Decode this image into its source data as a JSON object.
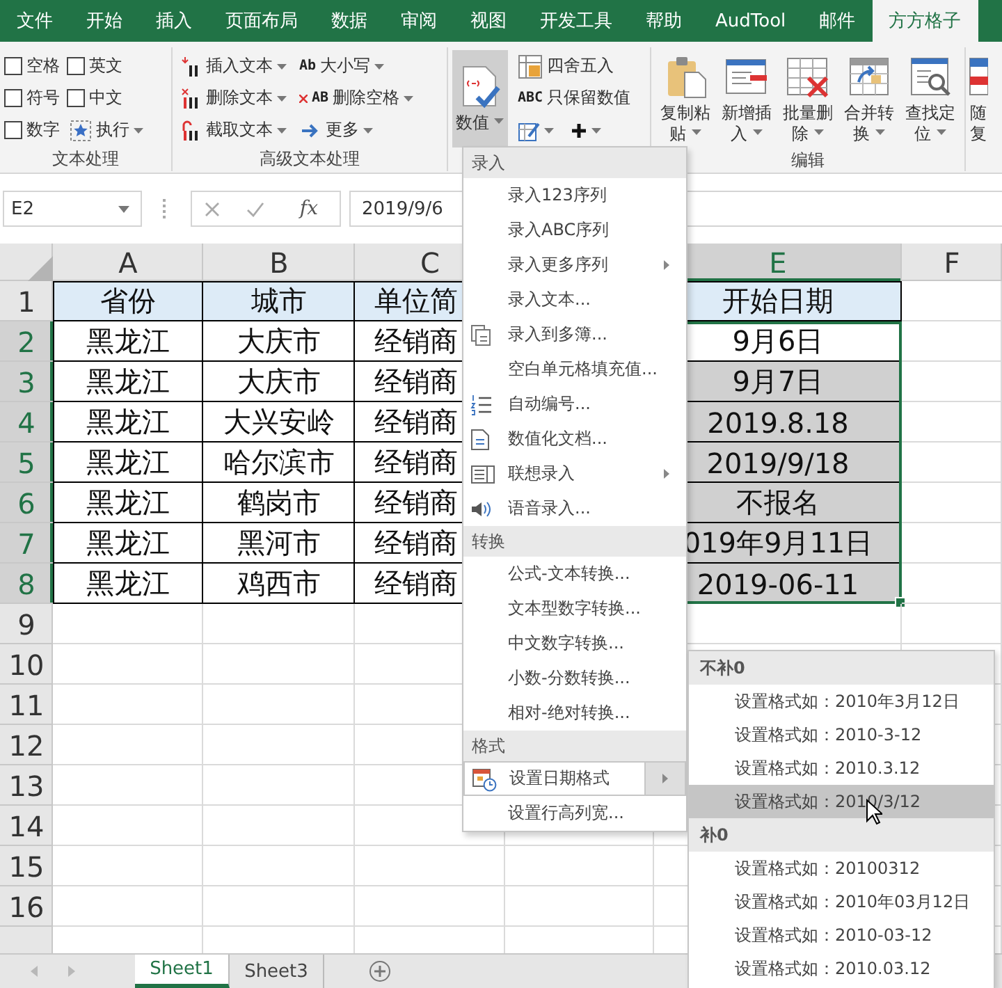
{
  "menu_tabs": [
    {
      "label": "文件",
      "selected": false
    },
    {
      "label": "开始",
      "selected": false
    },
    {
      "label": "插入",
      "selected": false
    },
    {
      "label": "页面布局",
      "selected": false
    },
    {
      "label": "数据",
      "selected": false
    },
    {
      "label": "审阅",
      "selected": false
    },
    {
      "label": "视图",
      "selected": false
    },
    {
      "label": "开发工具",
      "selected": false
    },
    {
      "label": "帮助",
      "selected": false
    },
    {
      "label": "AudTool",
      "selected": false
    },
    {
      "label": "邮件",
      "selected": false
    },
    {
      "label": "方方格子",
      "selected": true
    }
  ],
  "ribbon": {
    "groups": [
      {
        "label": "文本处理",
        "items": [
          {
            "kind": "checkbox",
            "label": "空格",
            "checked": false
          },
          {
            "kind": "checkbox",
            "label": "符号",
            "checked": false
          },
          {
            "kind": "checkbox",
            "label": "数字",
            "checked": false
          },
          {
            "kind": "checkbox",
            "label": "英文",
            "checked": false
          },
          {
            "kind": "checkbox",
            "label": "中文",
            "checked": false
          },
          {
            "kind": "small-button",
            "label": "执行",
            "dropdown": true
          }
        ]
      },
      {
        "label": "高级文本处理",
        "items": [
          {
            "kind": "small-button",
            "label": "插入文本",
            "dropdown": true
          },
          {
            "kind": "small-button",
            "label": "删除文本",
            "dropdown": true
          },
          {
            "kind": "small-button",
            "label": "截取文本",
            "dropdown": true
          },
          {
            "kind": "small-button",
            "label": "大小写",
            "icon_text": "Ab",
            "dropdown": true
          },
          {
            "kind": "small-button",
            "label": "删除空格",
            "icon_text": "AB",
            "dropdown": true
          },
          {
            "kind": "small-button",
            "label": "更多",
            "dropdown": true
          }
        ]
      },
      {
        "items": [
          {
            "kind": "large-button",
            "label": "数值",
            "pressed": true,
            "dropdown": true
          },
          {
            "kind": "small-button",
            "label": "四舍五入",
            "dropdown": false
          },
          {
            "kind": "small-button",
            "label": "只保留数值",
            "icon_text": "ABC",
            "dropdown": false
          },
          {
            "kind": "icon-button",
            "dropdown": true
          },
          {
            "kind": "icon-button",
            "dropdown": true
          }
        ]
      },
      {
        "label": "编辑",
        "items": [
          {
            "kind": "large-button",
            "label": "复制粘贴",
            "pressed": false,
            "dropdown": true
          },
          {
            "kind": "large-button",
            "label": "新增插入",
            "pressed": false,
            "dropdown": true
          },
          {
            "kind": "large-button",
            "label": "批量删除",
            "pressed": false,
            "dropdown": true
          },
          {
            "kind": "large-button",
            "label": "合并转换",
            "pressed": false,
            "dropdown": true
          },
          {
            "kind": "large-button",
            "label": "查找定位",
            "pressed": false,
            "dropdown": true
          }
        ]
      },
      {
        "items": [
          {
            "kind": "large-button",
            "label": "随复",
            "pressed": false,
            "dropdown": false
          }
        ]
      }
    ]
  },
  "formula_bar": {
    "name_box": "E2",
    "function_label": "fx",
    "formula": "2019/9/6"
  },
  "grid": {
    "columns": [
      {
        "letter": "A",
        "selected": false
      },
      {
        "letter": "B",
        "selected": false
      },
      {
        "letter": "C",
        "selected": false
      },
      {
        "letter": "E",
        "selected": true
      },
      {
        "letter": "F",
        "selected": false
      }
    ],
    "rows": [
      {
        "number": "1",
        "kind": "header",
        "highlighted": false,
        "selected": false,
        "cells": [
          "省份",
          "城市",
          "单位简",
          "开始日期"
        ]
      },
      {
        "number": "2",
        "kind": "data",
        "highlighted": true,
        "selected": false,
        "cells": [
          "黑龙江",
          "大庆市",
          "经销商",
          "9月6日"
        ]
      },
      {
        "number": "3",
        "kind": "data",
        "highlighted": true,
        "selected": true,
        "cells": [
          "黑龙江",
          "大庆市",
          "经销商",
          "9月7日"
        ]
      },
      {
        "number": "4",
        "kind": "data",
        "highlighted": true,
        "selected": true,
        "cells": [
          "黑龙江",
          "大兴安岭",
          "经销商",
          "2019.8.18"
        ]
      },
      {
        "number": "5",
        "kind": "data",
        "highlighted": true,
        "selected": true,
        "cells": [
          "黑龙江",
          "哈尔滨市",
          "经销商",
          "2019/9/18"
        ]
      },
      {
        "number": "6",
        "kind": "data",
        "highlighted": true,
        "selected": true,
        "cells": [
          "黑龙江",
          "鹤岗市",
          "经销商",
          "不报名"
        ]
      },
      {
        "number": "7",
        "kind": "data",
        "highlighted": true,
        "selected": true,
        "cells": [
          "黑龙江",
          "黑河市",
          "经销商",
          "019年9月11日"
        ]
      },
      {
        "number": "8",
        "kind": "data",
        "highlighted": true,
        "selected": true,
        "cells": [
          "黑龙江",
          "鸡西市",
          "经销商",
          "2019-06-11"
        ]
      },
      {
        "number": "9",
        "kind": "empty",
        "highlighted": false,
        "selected": false
      },
      {
        "number": "10",
        "kind": "empty",
        "highlighted": false,
        "selected": false
      },
      {
        "number": "11",
        "kind": "empty",
        "highlighted": false,
        "selected": false
      },
      {
        "number": "12",
        "kind": "empty",
        "highlighted": false,
        "selected": false
      },
      {
        "number": "13",
        "kind": "empty",
        "highlighted": false,
        "selected": false
      },
      {
        "number": "14",
        "kind": "empty",
        "highlighted": false,
        "selected": false
      },
      {
        "number": "15",
        "kind": "empty",
        "highlighted": false,
        "selected": false
      },
      {
        "number": "16",
        "kind": "empty",
        "highlighted": false,
        "selected": false
      }
    ]
  },
  "sheet_tabs": [
    {
      "label": "Sheet1",
      "selected": true
    },
    {
      "label": "Sheet3",
      "selected": false
    }
  ],
  "dropdown": {
    "sections": [
      {
        "title": "录入",
        "items": [
          {
            "label": "录入123序列",
            "submenu": false,
            "selected": false
          },
          {
            "label": "录入ABC序列",
            "submenu": false,
            "selected": false
          },
          {
            "label": "录入更多序列",
            "submenu": true,
            "selected": false
          },
          {
            "label": "录入文本...",
            "submenu": false,
            "selected": false
          },
          {
            "label": "录入到多簿...",
            "submenu": false,
            "selected": false
          },
          {
            "label": "空白单元格填充值...",
            "submenu": false,
            "selected": false
          },
          {
            "label": "自动编号...",
            "submenu": false,
            "selected": false
          },
          {
            "label": "数值化文档...",
            "submenu": false,
            "selected": false
          },
          {
            "label": "联想录入",
            "submenu": true,
            "selected": false
          },
          {
            "label": "语音录入...",
            "submenu": false,
            "selected": false
          }
        ]
      },
      {
        "title": "转换",
        "items": [
          {
            "label": "公式-文本转换...",
            "submenu": false,
            "selected": false
          },
          {
            "label": "文本型数字转换...",
            "submenu": false,
            "selected": false
          },
          {
            "label": "中文数字转换...",
            "submenu": false,
            "selected": false
          },
          {
            "label": "小数-分数转换...",
            "submenu": false,
            "selected": false
          },
          {
            "label": "相对-绝对转换...",
            "submenu": false,
            "selected": false
          }
        ]
      },
      {
        "title": "格式",
        "items": [
          {
            "label": "设置日期格式",
            "submenu": true,
            "selected": true
          },
          {
            "label": "设置行高列宽...",
            "submenu": false,
            "selected": false
          }
        ]
      }
    ]
  },
  "submenu": {
    "sections": [
      {
        "title": "不补0",
        "items": [
          {
            "label": "设置格式如：2010年3月12日",
            "selected": false
          },
          {
            "label": "设置格式如：2010-3-12",
            "selected": false
          },
          {
            "label": "设置格式如：2010.3.12",
            "selected": false
          },
          {
            "label": "设置格式如：2010/3/12",
            "selected": true
          }
        ]
      },
      {
        "title": "补0",
        "items": [
          {
            "label": "设置格式如：20100312",
            "selected": false
          },
          {
            "label": "设置格式如：2010年03月12日",
            "selected": false
          },
          {
            "label": "设置格式如：2010-03-12",
            "selected": false
          },
          {
            "label": "设置格式如：2010.03.12",
            "selected": false
          }
        ]
      }
    ]
  }
}
